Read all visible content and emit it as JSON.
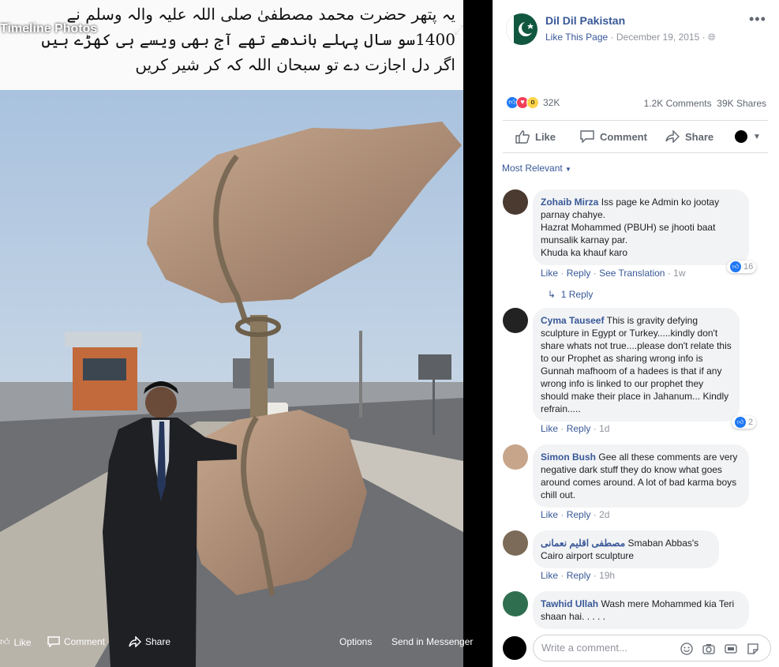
{
  "photo": {
    "caption_lines": [
      "یہ پتھر حضرت محمد مصطفیٰ صلی اللہ علیہ والہ وسلم نے",
      "1400سو سال پہلے باندھے تھے آج بھی ویسے ہی کھڑے ہیں",
      "اگر دل اجازت دے تو سبحان اللہ کہ کر شیر کریں"
    ],
    "overlay_title": "Timeline Photos",
    "bottom_bar": {
      "like": "Like",
      "comment": "Comment",
      "share": "Share",
      "options": "Options",
      "send": "Send in Messenger"
    }
  },
  "post": {
    "page_name": "Dil Dil Pakistan",
    "like_page": "Like This Page",
    "date": "December 19, 2015",
    "reaction_count": "32K",
    "comments_count": "1.2K Comments",
    "shares_count": "39K Shares",
    "actions": {
      "like": "Like",
      "comment": "Comment",
      "share": "Share"
    }
  },
  "sort_label": "Most Relevant",
  "comments": [
    {
      "author": "Zohaib Mirza",
      "text": "Iss page ke Admin ko jootay parnay chahye.\nHazrat Mohammed (PBUH) se jhooti baat munsalik karnay par.\nKhuda ka khauf karo",
      "actions": [
        "Like",
        "Reply",
        "See Translation"
      ],
      "time": "1w",
      "likes": "16"
    },
    {
      "author": "Cyma Tauseef",
      "text": "This is gravity defying sculpture in Egypt or Turkey.....kindly don't share whats not true....please don't relate this to our Prophet as sharing wrong info is Gunnah mafhoom of a hadees is that if any wrong info is linked to our prophet they should make their place in Jahanum... Kindly refrain.....",
      "actions": [
        "Like",
        "Reply"
      ],
      "time": "1d",
      "likes": "2"
    },
    {
      "author": "Simon Bush",
      "text": "Gee all these comments are very negative dark stuff they do know what goes around comes around. A lot of bad karma boys chill out.",
      "actions": [
        "Like",
        "Reply"
      ],
      "time": "2d"
    },
    {
      "author": "مصطفی اقلیم نعمانی",
      "text": "Smaban Abbas's Cairo airport sculpture",
      "actions": [
        "Like",
        "Reply"
      ],
      "time": "19h"
    },
    {
      "author": "Tawhid Ullah",
      "text": "Wash mere Mohammed kia Teri shaan hai. . . . .",
      "actions": [],
      "time": ""
    }
  ],
  "replies_link": "1 Reply",
  "write_placeholder": "Write a comment...",
  "colors": {
    "link": "#385898",
    "like_blue": "#2078f4",
    "love_red": "#f33e58",
    "wow_yellow": "#fcd34a"
  }
}
